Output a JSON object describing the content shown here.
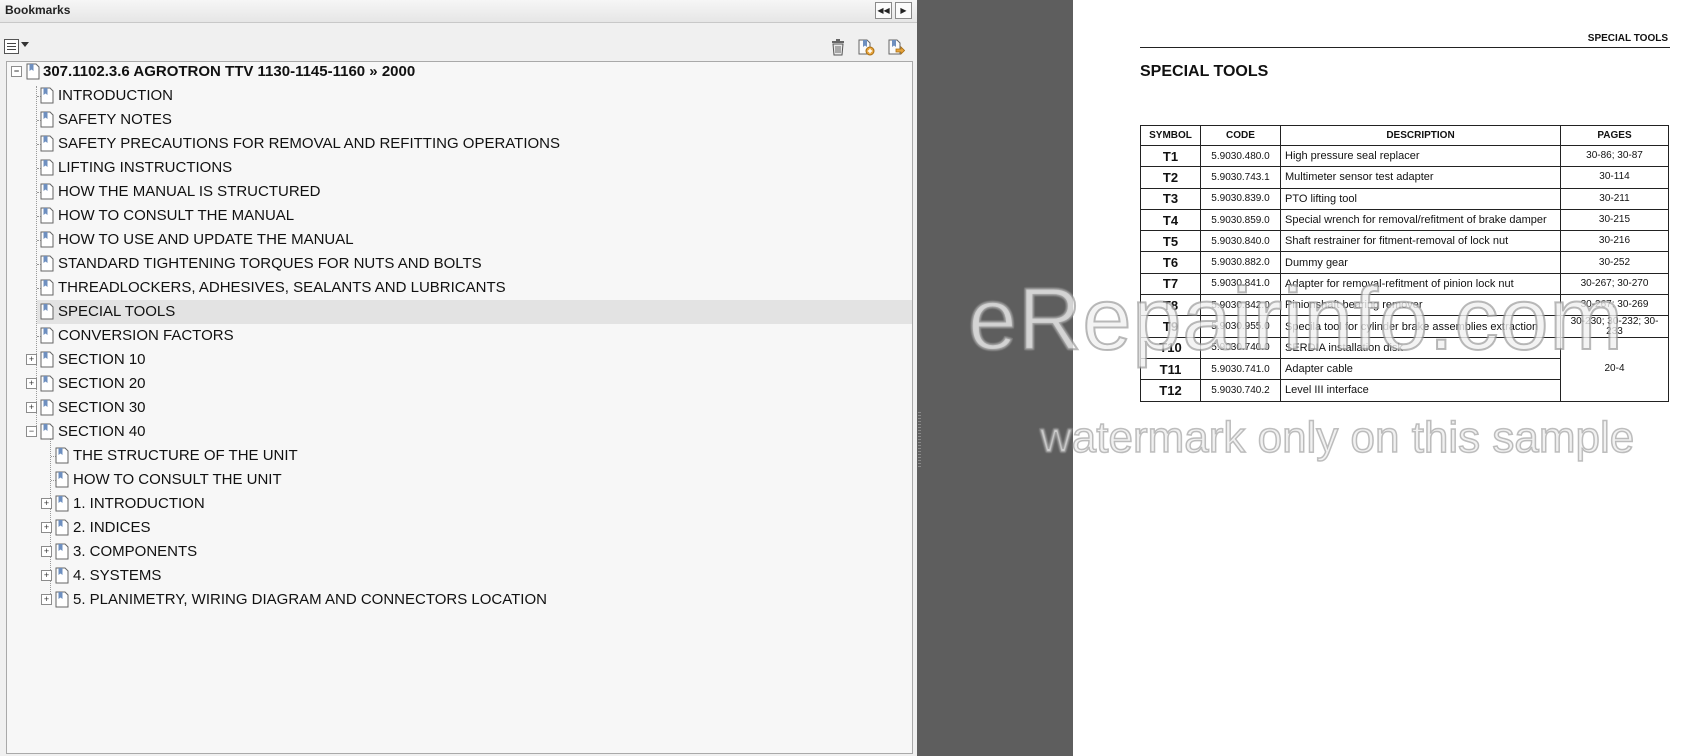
{
  "bookmarks_panel": {
    "title": "Bookmarks",
    "collapse_button": "◀◀",
    "expand_button": "▶",
    "toolbar": {
      "options_icon": "options-menu-icon",
      "delete_icon": "trash-icon",
      "new_bookmark_icon": "new-bookmark-icon",
      "properties_icon": "bookmark-properties-icon"
    },
    "tree": {
      "root": "307.1102.3.6 AGROTRON TTV 1130-1145-1160 » 2000",
      "items": [
        {
          "label": "INTRODUCTION",
          "level": 1,
          "expandable": false
        },
        {
          "label": "SAFETY NOTES",
          "level": 1,
          "expandable": false
        },
        {
          "label": "SAFETY PRECAUTIONS FOR REMOVAL AND REFITTING OPERATIONS",
          "level": 1,
          "expandable": false
        },
        {
          "label": "LIFTING INSTRUCTIONS",
          "level": 1,
          "expandable": false
        },
        {
          "label": "HOW THE MANUAL IS STRUCTURED",
          "level": 1,
          "expandable": false
        },
        {
          "label": "HOW TO CONSULT THE MANUAL",
          "level": 1,
          "expandable": false
        },
        {
          "label": "HOW TO USE AND UPDATE THE MANUAL",
          "level": 1,
          "expandable": false
        },
        {
          "label": "STANDARD TIGHTENING TORQUES FOR NUTS AND BOLTS",
          "level": 1,
          "expandable": false
        },
        {
          "label": "THREADLOCKERS, ADHESIVES, SEALANTS AND LUBRICANTS",
          "level": 1,
          "expandable": false
        },
        {
          "label": "SPECIAL TOOLS",
          "level": 1,
          "expandable": false,
          "selected": true
        },
        {
          "label": "CONVERSION FACTORS",
          "level": 1,
          "expandable": false
        },
        {
          "label": "SECTION 10",
          "level": 1,
          "expandable": true,
          "expanded": false
        },
        {
          "label": "SECTION 20",
          "level": 1,
          "expandable": true,
          "expanded": false
        },
        {
          "label": "SECTION 30",
          "level": 1,
          "expandable": true,
          "expanded": false
        },
        {
          "label": "SECTION 40",
          "level": 1,
          "expandable": true,
          "expanded": true
        },
        {
          "label": "THE STRUCTURE OF THE UNIT",
          "level": 2,
          "expandable": false
        },
        {
          "label": "HOW TO CONSULT THE UNIT",
          "level": 2,
          "expandable": false
        },
        {
          "label": "1. INTRODUCTION",
          "level": 2,
          "expandable": true,
          "expanded": false
        },
        {
          "label": "2. INDICES",
          "level": 2,
          "expandable": true,
          "expanded": false
        },
        {
          "label": "3. COMPONENTS",
          "level": 2,
          "expandable": true,
          "expanded": false
        },
        {
          "label": "4. SYSTEMS",
          "level": 2,
          "expandable": true,
          "expanded": false
        },
        {
          "label": "5. PLANIMETRY, WIRING DIAGRAM AND CONNECTORS LOCATION",
          "level": 2,
          "expandable": true,
          "expanded": false
        }
      ]
    }
  },
  "document": {
    "running_head": "SPECIAL TOOLS",
    "title": "SPECIAL TOOLS",
    "table": {
      "headers": [
        "SYMBOL",
        "CODE",
        "DESCRIPTION",
        "PAGES"
      ],
      "rows": [
        {
          "symbol": "T1",
          "code": "5.9030.480.0",
          "description": "High pressure seal replacer",
          "pages": "30-86; 30-87"
        },
        {
          "symbol": "T2",
          "code": "5.9030.743.1",
          "description": "Multimeter sensor test adapter",
          "pages": "30-114"
        },
        {
          "symbol": "T3",
          "code": "5.9030.839.0",
          "description": "PTO lifting tool",
          "pages": "30-211"
        },
        {
          "symbol": "T4",
          "code": "5.9030.859.0",
          "description": "Special wrench for removal/refitment of brake damper",
          "pages": "30-215"
        },
        {
          "symbol": "T5",
          "code": "5.9030.840.0",
          "description": "Shaft restrainer for fitment-removal of lock nut",
          "pages": "30-216"
        },
        {
          "symbol": "T6",
          "code": "5.9030.882.0",
          "description": "Dummy gear",
          "pages": "30-252"
        },
        {
          "symbol": "T7",
          "code": "5.9030.841.0",
          "description": "Adapter for removal-refitment of pinion lock nut",
          "pages": "30-267; 30-270"
        },
        {
          "symbol": "T8",
          "code": "5.9030.842.0",
          "description": "Pinionshaft bearing remover",
          "pages": "30-267; 30-269"
        },
        {
          "symbol": "T9",
          "code": "5.9030.955.0",
          "description": "Specila tool for cylinder brake assemblies extraction",
          "pages": "30-230; 30-232; 30-233"
        },
        {
          "symbol": "T10",
          "code": "5.9030.740.0",
          "description": "SERDIA installation disk",
          "pages": "20-4"
        },
        {
          "symbol": "T11",
          "code": "5.9030.741.0",
          "description": "Adapter cable",
          "pages": ""
        },
        {
          "symbol": "T12",
          "code": "5.9030.740.2",
          "description": "Level III interface",
          "pages": ""
        }
      ]
    }
  },
  "watermark": {
    "line1": "eRepairinfo.com",
    "line2": "watermark only on this sample"
  }
}
